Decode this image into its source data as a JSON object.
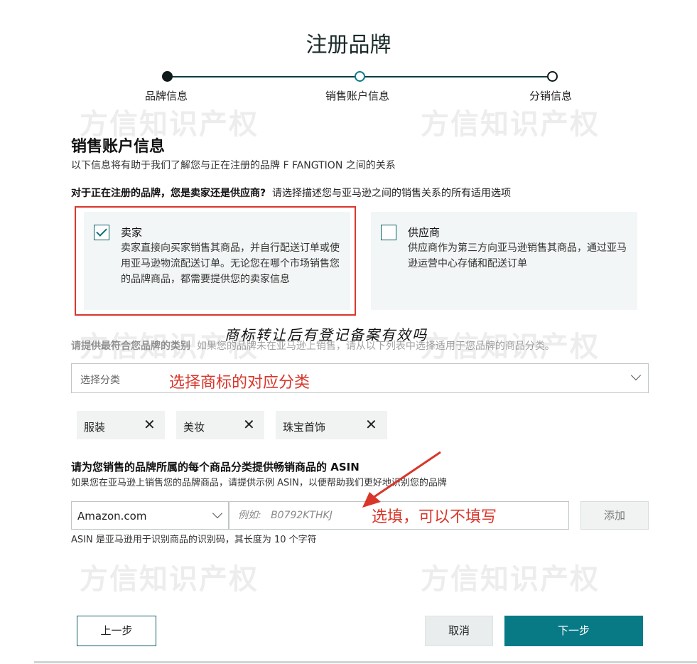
{
  "page_title": "注册品牌",
  "stepper": {
    "steps": [
      {
        "label": "品牌信息",
        "state": "done"
      },
      {
        "label": "销售账户信息",
        "state": "active"
      },
      {
        "label": "分销信息",
        "state": "todo"
      }
    ]
  },
  "watermark_text": "方信知识产权",
  "section": {
    "title": "销售账户信息",
    "subtitle": "以下信息将有助于我们了解您与正在注册的品牌 F FANGTION 之间的关系"
  },
  "relationship_question": {
    "bold": "对于正在注册的品牌，您是卖家还是供应商?",
    "hint": "请选择描述您与亚马逊之间的销售关系的所有适用选项"
  },
  "options": [
    {
      "name": "卖家",
      "checked": true,
      "description": "卖家直接向买家销售其商品，并自行配送订单或使用亚马逊物流配送订单。无论您在哪个市场销售您的品牌商品，都需要提供您的卖家信息"
    },
    {
      "name": "供应商",
      "checked": false,
      "description": "供应商作为第三方向亚马逊销售其商品，通过亚马逊运营中心存储和配送订单"
    }
  ],
  "handwritten_note": "商标转让后有登记备案有效吗",
  "category": {
    "label_bold": "请提供最符合您品牌的类别",
    "label_hint": "如果您的品牌未在亚马逊上销售，请从以下列表中选择适用于您品牌的商品分类。",
    "placeholder": "选择分类",
    "annotation": "选择商标的对应分类",
    "tags": [
      "服装",
      "美妆",
      "珠宝首饰"
    ],
    "remove_icon": "close-icon"
  },
  "asin": {
    "title": "请为您销售的品牌所属的每个商品分类提供畅销商品的 ASIN",
    "subtitle": "如果您在亚马逊上销售您的品牌商品，请提供示例 ASIN，以便帮助我们更好地识别您的品牌",
    "marketplace": "Amazon.com",
    "placeholder": "例如:   B0792KTHKJ",
    "annotation": "选填，可以不填写",
    "add_label": "添加",
    "hint": "ASIN 是亚马逊用于识别商品的识别码，其长度为 10 个字符"
  },
  "buttons": {
    "prev": "上一步",
    "cancel": "取消",
    "next": "下一步"
  },
  "colors": {
    "accent": "#087a86",
    "annotation_red": "#d9362b",
    "card_bg": "#f3f6f6"
  }
}
